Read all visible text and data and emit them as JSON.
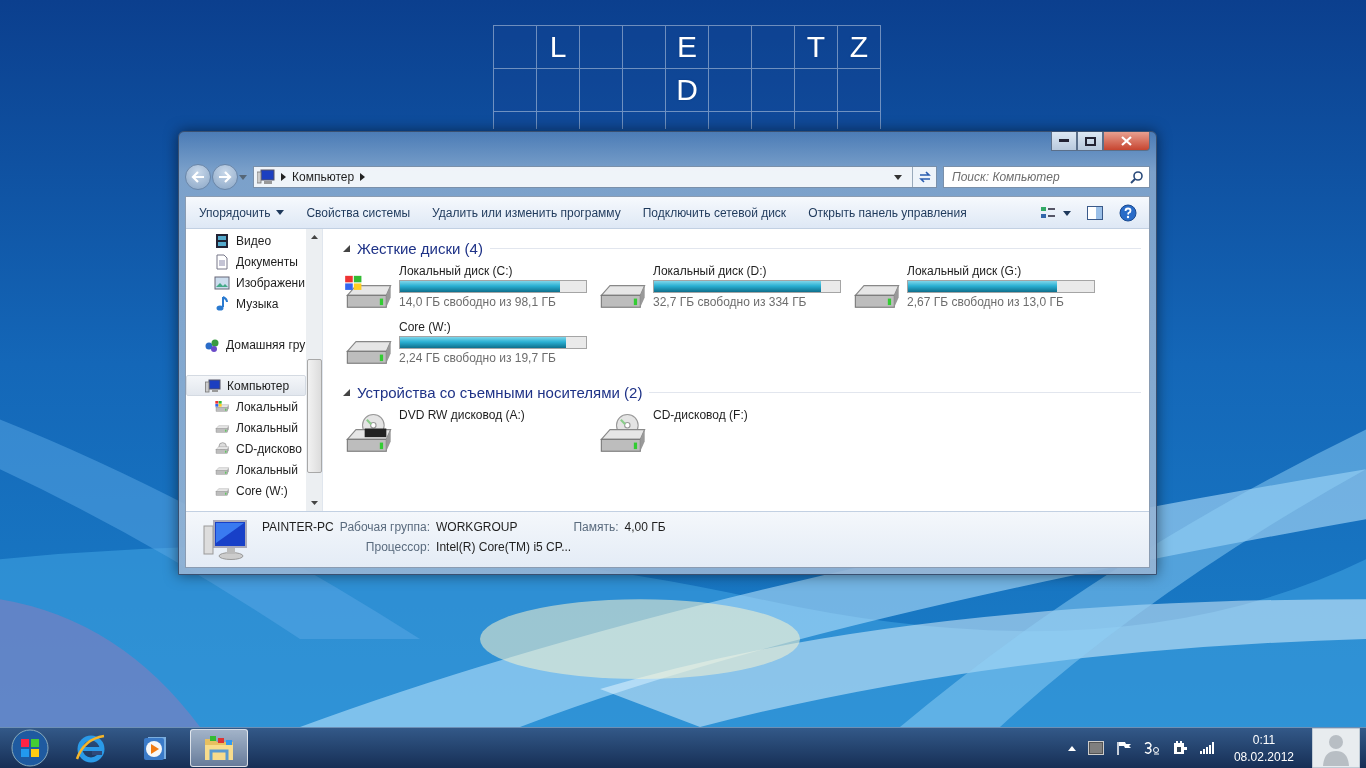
{
  "desktop_widget": {
    "rows": [
      {
        "cells": [
          {
            "kind": "empty"
          },
          {
            "kind": "letter",
            "letter": "L"
          },
          {
            "kind": "empty"
          },
          {
            "kind": "empty"
          },
          {
            "kind": "letter",
            "letter": "E"
          },
          {
            "kind": "empty"
          },
          {
            "kind": "empty"
          },
          {
            "kind": "letter",
            "letter": "T"
          },
          {
            "kind": "letter",
            "letter": "Z"
          }
        ]
      },
      {
        "cells": [
          {
            "kind": "empty"
          },
          {
            "kind": "empty"
          },
          {
            "kind": "empty"
          },
          {
            "kind": "empty"
          },
          {
            "kind": "letter",
            "letter": "D"
          },
          {
            "kind": "empty"
          },
          {
            "kind": "empty"
          },
          {
            "kind": "empty"
          },
          {
            "kind": "empty"
          }
        ]
      },
      {
        "cells": [
          {
            "kind": "empty"
          },
          {
            "kind": "empty"
          },
          {
            "kind": "empty"
          },
          {
            "kind": "empty"
          },
          {
            "kind": "empty"
          },
          {
            "kind": "empty"
          },
          {
            "kind": "empty"
          },
          {
            "kind": "empty"
          },
          {
            "kind": "empty"
          }
        ]
      }
    ]
  },
  "window": {
    "address_bar": {
      "path": [
        "Компьютер"
      ]
    },
    "search": {
      "placeholder": "Поиск: Компьютер"
    },
    "toolbar": {
      "buttons": [
        {
          "label": "Упорядочить",
          "dropdown": true
        },
        {
          "label": "Свойства системы",
          "dropdown": false
        },
        {
          "label": "Удалить или изменить программу",
          "dropdown": false
        },
        {
          "label": "Подключить сетевой диск",
          "dropdown": false
        },
        {
          "label": "Открыть панель управления",
          "dropdown": false
        }
      ]
    },
    "nav_pane": {
      "sections": [
        {
          "kind": "nested",
          "items": [
            {
              "label": "Видео",
              "kind": "video",
              "selected": false
            },
            {
              "label": "Документы",
              "kind": "documents",
              "selected": false
            },
            {
              "label": "Изображени",
              "kind": "pictures",
              "selected": false
            },
            {
              "label": "Музыка",
              "kind": "music",
              "selected": false
            }
          ]
        },
        {
          "kind": "root",
          "items": [
            {
              "label": "Домашняя гру",
              "kind": "homegroup",
              "selected": false
            }
          ]
        },
        {
          "kind": "root",
          "items": [
            {
              "label": "Компьютер",
              "kind": "computer",
              "selected": true,
              "children": [
                {
                  "label": "Локальный",
                  "kind": "system_drive",
                  "selected": false
                },
                {
                  "label": "Локальный",
                  "kind": "drive",
                  "selected": false
                },
                {
                  "label": "CD-дисково",
                  "kind": "cd",
                  "selected": false
                },
                {
                  "label": "Локальный",
                  "kind": "drive",
                  "selected": false
                },
                {
                  "label": "Core (W:)",
                  "kind": "drive",
                  "selected": false
                }
              ]
            }
          ]
        }
      ]
    },
    "groups": [
      {
        "title": "Жесткие диски (4)",
        "expanded": true,
        "items": [
          {
            "name": "Локальный диск (C:)",
            "kind": "system_drive",
            "level": 0.86,
            "free": "14,0 ГБ свободно из 98,1 ГБ"
          },
          {
            "name": "Локальный диск (D:)",
            "kind": "drive",
            "level": 0.9,
            "free": "32,7 ГБ свободно из 334 ГБ"
          },
          {
            "name": "Локальный диск (G:)",
            "kind": "drive",
            "level": 0.8,
            "free": "2,67 ГБ свободно из 13,0 ГБ"
          },
          {
            "name": "Core (W:)",
            "kind": "drive",
            "level": 0.89,
            "free": "2,24 ГБ свободно из 19,7 ГБ"
          }
        ]
      },
      {
        "title": "Устройства со съемными носителями (2)",
        "expanded": true,
        "items": [
          {
            "name": "DVD RW дисковод (A:)",
            "kind": "dvd"
          },
          {
            "name": "CD-дисковод (F:)",
            "kind": "cd"
          }
        ]
      }
    ],
    "details": {
      "computer_name": "PAINTER-PC",
      "workgroup": {
        "label": "Рабочая группа:",
        "value": "WORKGROUP"
      },
      "memory": {
        "label": "Память:",
        "value": "4,00 ГБ"
      },
      "processor": {
        "label": "Процессор:",
        "value": "Intel(R) Core(TM) i5 CP..."
      }
    }
  },
  "taskbar": {
    "buttons": [
      {
        "kind": "start",
        "selected": false
      },
      {
        "kind": "ie",
        "selected": false
      },
      {
        "kind": "media",
        "selected": false
      },
      {
        "kind": "explorer",
        "selected": true
      }
    ],
    "tray": {
      "time": "0:11",
      "date": "08.02.2012"
    }
  }
}
